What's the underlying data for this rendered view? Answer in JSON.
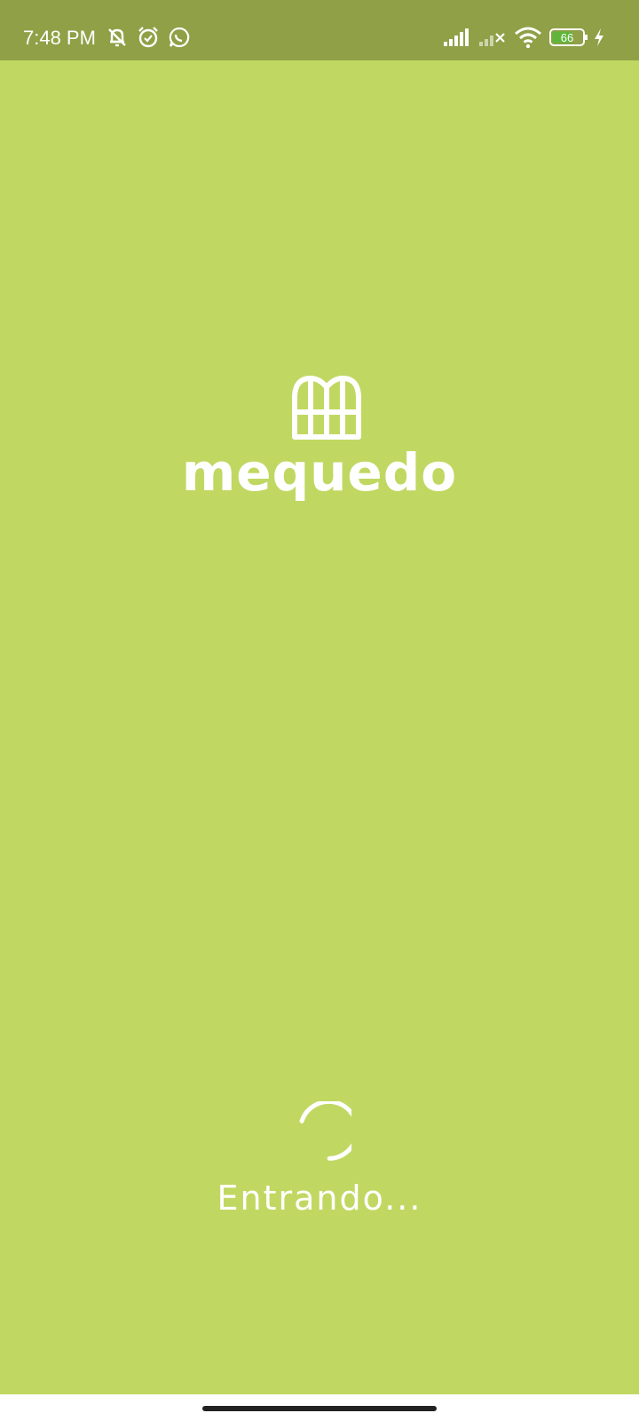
{
  "status_bar": {
    "time": "7:48 PM",
    "battery_level": "66",
    "icons": [
      "muted-notification-icon",
      "alarm-icon",
      "whatsapp-icon",
      "signal-icon",
      "signal-no-service-icon",
      "wifi-icon",
      "battery-icon",
      "charging-icon"
    ]
  },
  "app": {
    "logo_text": "mequedo",
    "loading_text": "Entrando..."
  },
  "colors": {
    "background": "#c0d862",
    "status_bar": "#8fa046",
    "foreground": "#ffffff"
  }
}
